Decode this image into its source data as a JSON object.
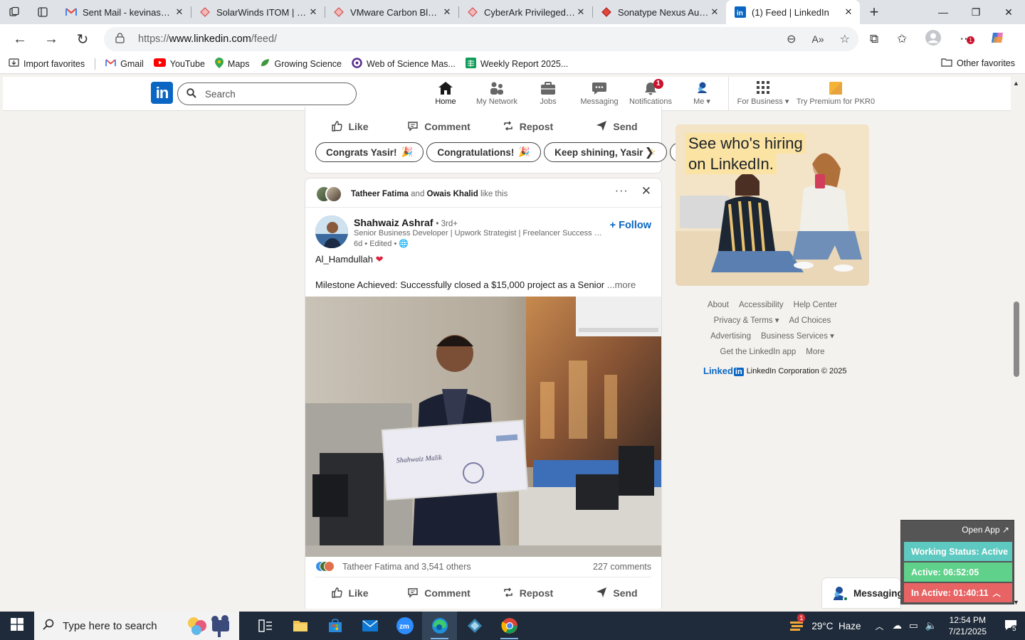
{
  "browser": {
    "tabs": [
      {
        "title": "Sent Mail - kevinasutton",
        "icon": "gmail-icon",
        "active": false
      },
      {
        "title": "SolarWinds ITOM | IT Operations",
        "icon": "diamond-icon",
        "active": false
      },
      {
        "title": "VMware Carbon Black EDR",
        "icon": "diamond-icon",
        "active": false
      },
      {
        "title": "CyberArk Privileged Access",
        "icon": "diamond-icon",
        "active": false
      },
      {
        "title": "Sonatype Nexus Auditor",
        "icon": "diamond-icon",
        "active": false
      },
      {
        "title": "(1) Feed | LinkedIn",
        "icon": "linkedin-icon",
        "active": true
      }
    ],
    "url_prefix": "https://",
    "url_host": "www.linkedin.com",
    "url_path": "/feed/",
    "favorites": [
      {
        "label": "Import favorites",
        "icon": "import-icon"
      },
      {
        "label": "Gmail",
        "icon": "gmail-icon"
      },
      {
        "label": "YouTube",
        "icon": "youtube-icon"
      },
      {
        "label": "Maps",
        "icon": "maps-icon"
      },
      {
        "label": "Growing Science",
        "icon": "growing-science-icon"
      },
      {
        "label": "Web of Science Mas...",
        "icon": "web-of-science-icon"
      },
      {
        "label": "Weekly Report 2025...",
        "icon": "sheets-icon"
      }
    ],
    "other_favorites": "Other favorites"
  },
  "linkedin": {
    "search_placeholder": "Search",
    "nav": [
      {
        "label": "Home",
        "icon": "home-icon",
        "active": true
      },
      {
        "label": "My Network",
        "icon": "network-icon"
      },
      {
        "label": "Jobs",
        "icon": "jobs-icon"
      },
      {
        "label": "Messaging",
        "icon": "messaging-icon"
      },
      {
        "label": "Notifications",
        "icon": "bell-icon",
        "badge": "1"
      },
      {
        "label": "Me",
        "icon": "avatar-icon"
      }
    ],
    "for_business": "For Business",
    "premium": "Try Premium for PKR0"
  },
  "top_card": {
    "actions": [
      "Like",
      "Comment",
      "Repost",
      "Send"
    ],
    "chips": [
      "Congrats Yasir!",
      "Congratulations!",
      "Keep shining, Yasir"
    ]
  },
  "post": {
    "social_names_1": "Tatheer Fatima",
    "social_and": "and",
    "social_names_2": "Owais Khalid",
    "social_suffix": "like this",
    "author": "Shahwaiz Ashraf",
    "degree": "• 3rd+",
    "headline": "Senior Business Developer | Upwork Strategist | Freelancer Success Con...",
    "meta": "6d • Edited •",
    "follow": "+ Follow",
    "line1": "Al_Hamdullah",
    "line2": "Milestone Achieved: Successfully closed a $15,000 project as a Senior",
    "more": "...more",
    "check_payee": "Shahwaiz Malik",
    "reactions_text": "Tatheer Fatima and 3,541 others",
    "comments": "227 comments",
    "actions": [
      "Like",
      "Comment",
      "Repost",
      "Send"
    ]
  },
  "ad": {
    "line1": "See who's hiring",
    "line2": "on LinkedIn."
  },
  "footer": {
    "rows": [
      [
        "About",
        "Accessibility",
        "Help Center"
      ],
      [
        "Privacy & Terms ▾",
        "Ad Choices"
      ],
      [
        "Advertising",
        "Business Services ▾"
      ],
      [
        "Get the LinkedIn app",
        "More"
      ]
    ],
    "brand": "Linked",
    "brand_in": "in",
    "copyright": "LinkedIn Corporation © 2025"
  },
  "messaging": "Messaging",
  "widget": {
    "open_app": "Open App ↗",
    "working": "Working Status: Active",
    "active": "Active: 06:52:05",
    "inactive": "In Active: 01:40:11"
  },
  "taskbar": {
    "search_placeholder": "Type here to search",
    "weather": "29°C  Haze",
    "weather_badge": "1",
    "time": "12:54 PM",
    "date": "7/21/2025",
    "notif_count": "5"
  },
  "colors": {
    "linkedin_blue": "#0a66c2",
    "working_green": "#5ec9c0",
    "active_green": "#5fd18a",
    "inactive_red": "#e86363"
  }
}
